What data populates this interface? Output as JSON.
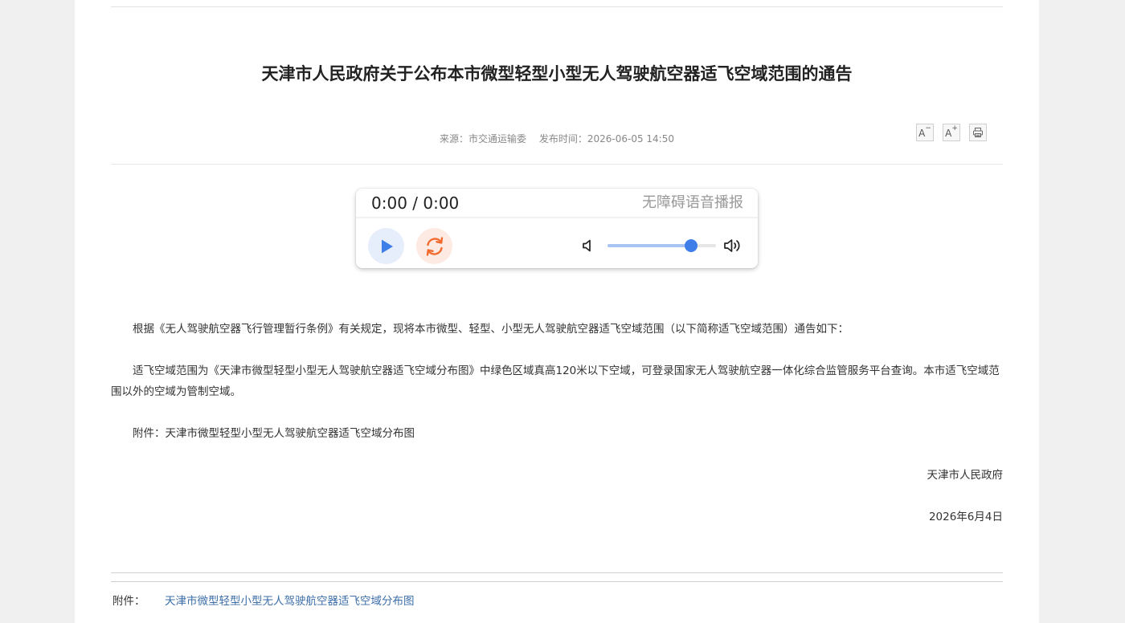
{
  "article": {
    "title": "天津市人民政府关于公布本市微型轻型小型无人驾驶航空器适飞空域范围的通告",
    "source": "来源：市交通运输委",
    "publish_time": "发布时间：2026-06-05 14:50"
  },
  "tools": {
    "decrease_font_label": "A",
    "decrease_font_mark": "−",
    "increase_font_label": "A",
    "increase_font_mark": "+",
    "icons": [
      "font-decrease-icon",
      "font-increase-icon",
      "print-icon"
    ]
  },
  "player": {
    "time": "0:00 / 0:00",
    "label": "无障碍语音播报",
    "volume_level": 0.77,
    "colors": {
      "play": "#3f7ee8",
      "replay": "#f26a2e",
      "track_fill": "#a9c3f2",
      "knob": "#3f7ee8"
    },
    "icons": [
      "play-icon",
      "replay-icon",
      "volume-low-icon",
      "volume-high-icon"
    ]
  },
  "body": {
    "paragraph_1": "根据《无人驾驶航空器飞行管理暂行条例》有关规定，现将本市微型、轻型、小型无人驾驶航空器适飞空域范围（以下简称适飞空域范围）通告如下：",
    "paragraph_2": "适飞空域范围为《天津市微型轻型小型无人驾驶航空器适飞空域分布图》中绿色区域真高120米以下空域，可登录国家无人驾驶航空器一体化综合监管服务平台查询。本市适飞空域范围以外的空域为管制空域。",
    "paragraph_3": "附件：天津市微型轻型小型无人驾驶航空器适飞空域分布图",
    "signature_org": "天津市人民政府",
    "signature_date": "2026年6月4日"
  },
  "attachments": {
    "label": "附件：",
    "link_text": "天津市微型轻型小型无人驾驶航空器适飞空域分布图",
    "link_color": "#3c6ea8"
  }
}
